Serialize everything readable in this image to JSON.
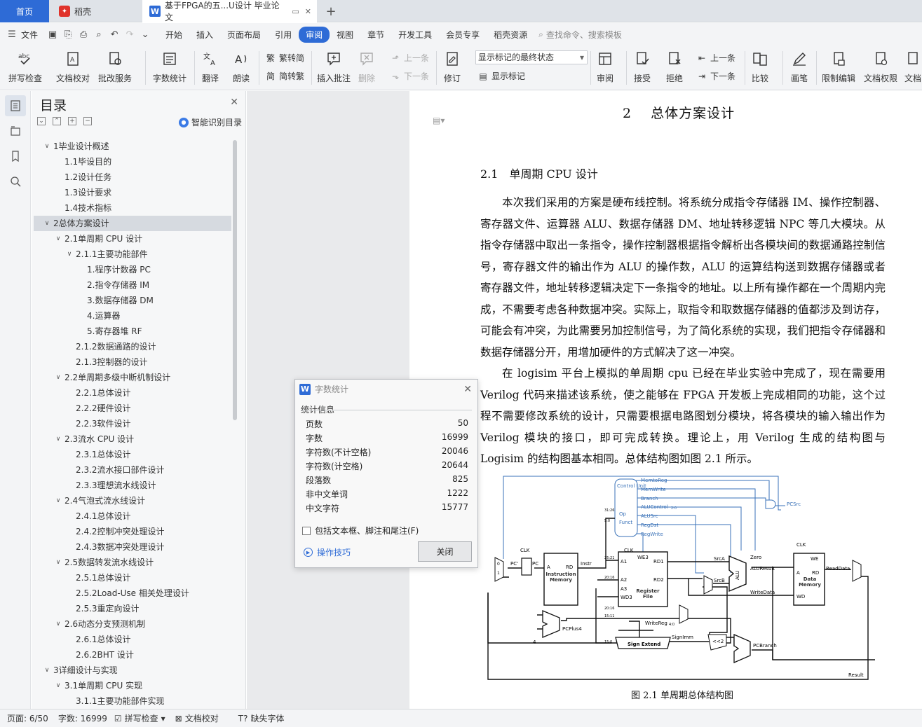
{
  "tabs": {
    "home": "首页",
    "docer": "稻壳",
    "document": "基于FPGA的五...U设计 毕业论文",
    "add": "+"
  },
  "menu": {
    "file": "文件",
    "items": [
      "开始",
      "插入",
      "页面布局",
      "引用",
      "审阅",
      "视图",
      "章节",
      "开发工具",
      "会员专享",
      "稻壳资源"
    ],
    "active_index": 4,
    "search_placeholder": "查找命令、搜索模板"
  },
  "ribbon": {
    "spellcheck": "拼写检查",
    "doc_proof": "文档校对",
    "batch_service": "批改服务",
    "word_count": "字数统计",
    "translate": "翻译",
    "read_aloud": "朗读",
    "trad_to_simp": "繁转简",
    "simp_to_trad": "简转繁",
    "insert_comment": "插入批注",
    "delete": "删除",
    "prev_comment": "上一条",
    "next_comment": "下一条",
    "track_changes": "修订",
    "markup_state": "显示标记的最终状态",
    "show_markup": "显示标记",
    "review_pane": "审阅",
    "accept": "接受",
    "reject": "拒绝",
    "prev_change": "上一条",
    "next_change": "下一条",
    "compare": "比较",
    "pen": "画笔",
    "restrict_edit": "限制编辑",
    "doc_permission": "文档权限",
    "doc_more": "文档"
  },
  "toc": {
    "title": "目录",
    "smart": "智能识别目录",
    "items": [
      {
        "text": "1毕业设计概述",
        "level": 0,
        "arrow": true
      },
      {
        "text": "1.1毕设目的",
        "level": 1,
        "arrow": false
      },
      {
        "text": "1.2设计任务",
        "level": 1,
        "arrow": false
      },
      {
        "text": "1.3设计要求",
        "level": 1,
        "arrow": false
      },
      {
        "text": "1.4技术指标",
        "level": 1,
        "arrow": false
      },
      {
        "text": "2总体方案设计",
        "level": 0,
        "arrow": true,
        "selected": true
      },
      {
        "text": "2.1单周期 CPU 设计",
        "level": 1,
        "arrow": true
      },
      {
        "text": "2.1.1主要功能部件",
        "level": 2,
        "arrow": true
      },
      {
        "text": "1.程序计数器 PC",
        "level": 3,
        "arrow": false
      },
      {
        "text": "2.指令存储器 IM",
        "level": 3,
        "arrow": false
      },
      {
        "text": "3.数据存储器 DM",
        "level": 3,
        "arrow": false
      },
      {
        "text": "4.运算器",
        "level": 3,
        "arrow": false
      },
      {
        "text": "5.寄存器堆 RF",
        "level": 3,
        "arrow": false
      },
      {
        "text": "2.1.2数据通路的设计",
        "level": 2,
        "arrow": false
      },
      {
        "text": "2.1.3控制器的设计",
        "level": 2,
        "arrow": false
      },
      {
        "text": "2.2单周期多级中断机制设计",
        "level": 1,
        "arrow": true
      },
      {
        "text": "2.2.1总体设计",
        "level": 2,
        "arrow": false
      },
      {
        "text": "2.2.2硬件设计",
        "level": 2,
        "arrow": false
      },
      {
        "text": "2.2.3软件设计",
        "level": 2,
        "arrow": false
      },
      {
        "text": "2.3流水 CPU 设计",
        "level": 1,
        "arrow": true
      },
      {
        "text": "2.3.1总体设计",
        "level": 2,
        "arrow": false
      },
      {
        "text": "2.3.2流水接口部件设计",
        "level": 2,
        "arrow": false
      },
      {
        "text": "2.3.3理想流水线设计",
        "level": 2,
        "arrow": false
      },
      {
        "text": "2.4气泡式流水线设计",
        "level": 1,
        "arrow": true
      },
      {
        "text": "2.4.1总体设计",
        "level": 2,
        "arrow": false
      },
      {
        "text": "2.4.2控制冲突处理设计",
        "level": 2,
        "arrow": false
      },
      {
        "text": "2.4.3数据冲突处理设计",
        "level": 2,
        "arrow": false
      },
      {
        "text": "2.5数据转发流水线设计",
        "level": 1,
        "arrow": true
      },
      {
        "text": "2.5.1总体设计",
        "level": 2,
        "arrow": false
      },
      {
        "text": "2.5.2Load-Use 相关处理设计",
        "level": 2,
        "arrow": false
      },
      {
        "text": "2.5.3重定向设计",
        "level": 2,
        "arrow": false
      },
      {
        "text": "2.6动态分支预测机制",
        "level": 1,
        "arrow": true
      },
      {
        "text": "2.6.1总体设计",
        "level": 2,
        "arrow": false
      },
      {
        "text": "2.6.2BHT 设计",
        "level": 2,
        "arrow": false
      },
      {
        "text": "3详细设计与实现",
        "level": 0,
        "arrow": true
      },
      {
        "text": "3.1单周期 CPU 实现",
        "level": 1,
        "arrow": true
      },
      {
        "text": "3.1.1主要功能部件实现",
        "level": 2,
        "arrow": false
      }
    ]
  },
  "document": {
    "heading1": "2　 总体方案设计",
    "heading2": "2.1　单周期 CPU 设计",
    "para1": "本次我们采用的方案是硬布线控制。将系统分成指令存储器 IM、操作控制器、寄存器文件、运算器 ALU、数据存储器 DM、地址转移逻辑 NPC 等几大模块。从指令存储器中取出一条指令，操作控制器根据指令解析出各模块间的数据通路控制信号，寄存器文件的输出作为 ALU 的操作数，ALU 的运算结构送到数据存储器或者寄存器文件，地址转移逻辑决定下一条指令的地址。以上所有操作都在一个周期内完成，不需要考虑各种数据冲突。实际上，取指令和取数据存储器的值都涉及到访存，可能会有冲突，为此需要另加控制信号，为了简化系统的实现，我们把指令存储器和数据存储器分开，用增加硬件的方式解决了这一冲突。",
    "para2": "在 logisim 平台上模拟的单周期 cpu 已经在毕业实验中完成了，现在需要用 Verilog 代码来描述该系统，使之能够在 FPGA 开发板上完成相同的功能，这个过程不需要修改系统的设计，只需要根据电路图划分模块，将各模块的输入输出作为 Verilog 模块的接口，即可完成转换。理论上，用 Verilog 生成的结构图与 Logisim 的结构图基本相同。总体结构图如图  2.1 所示。",
    "figure_caption": "图  2.1  单周期总体结构图",
    "diagram": {
      "control_unit": "Control Unit",
      "signals": [
        "MemtoReg",
        "MemWrite",
        "Branch",
        "ALUControl",
        "ALUSrc",
        "RegDst",
        "RegWrite"
      ],
      "alu_sub": "2:0",
      "op": "Op",
      "funct": "Funct",
      "pcsrc": "PCSrc",
      "clk": "CLK",
      "pc_prime": "PC'",
      "pc": "PC",
      "a": "A",
      "rd": "RD",
      "instr_mem": "Instruction Memory",
      "instr": "Instr",
      "a1": "A1",
      "a2": "A2",
      "a3": "A3",
      "wd3": "WD3",
      "we3": "WE3",
      "rd1": "RD1",
      "rd2": "RD2",
      "reg_file": "Register File",
      "srca": "SrcA",
      "srcb": "SrcB",
      "zero": "Zero",
      "alu": "ALU",
      "aluresult": "ALUResult",
      "writedata": "WriteData",
      "we": "WE",
      "data_mem": "Data Memory",
      "wd": "WD",
      "readdata": "ReadData",
      "writereg": "WriteReg",
      "writereg_sub": "4:0",
      "pcplus4": "PCPlus4",
      "four": "4",
      "signext": "Sign Extend",
      "signimm": "SignImm",
      "shift": "<<2",
      "pcbranch": "PCBranch",
      "result": "Result",
      "bits": [
        "31:26",
        "5:0",
        "25:21",
        "20:16",
        "20:16",
        "15:11",
        "15:0"
      ],
      "mux0": "0",
      "mux1": "1"
    }
  },
  "dialog": {
    "title": "字数统计",
    "section": "统计信息",
    "rows": [
      {
        "label": "页数",
        "value": "50"
      },
      {
        "label": "字数",
        "value": "16999"
      },
      {
        "label": "字符数(不计空格)",
        "value": "20046"
      },
      {
        "label": "字符数(计空格)",
        "value": "20644"
      },
      {
        "label": "段落数",
        "value": "825"
      },
      {
        "label": "非中文单词",
        "value": "1222"
      },
      {
        "label": "中文字符",
        "value": "15777"
      }
    ],
    "checkbox": "包括文本框、脚注和尾注(F)",
    "tip": "操作技巧",
    "close": "关闭"
  },
  "status": {
    "page": "页面: 6/50",
    "words": "字数: 16999",
    "spell": "拼写检查",
    "proof": "文档校对",
    "missing_font": "缺失字体"
  },
  "colors": {
    "accent": "#2e6bd6",
    "diagram_blue": "#3a72b8"
  }
}
